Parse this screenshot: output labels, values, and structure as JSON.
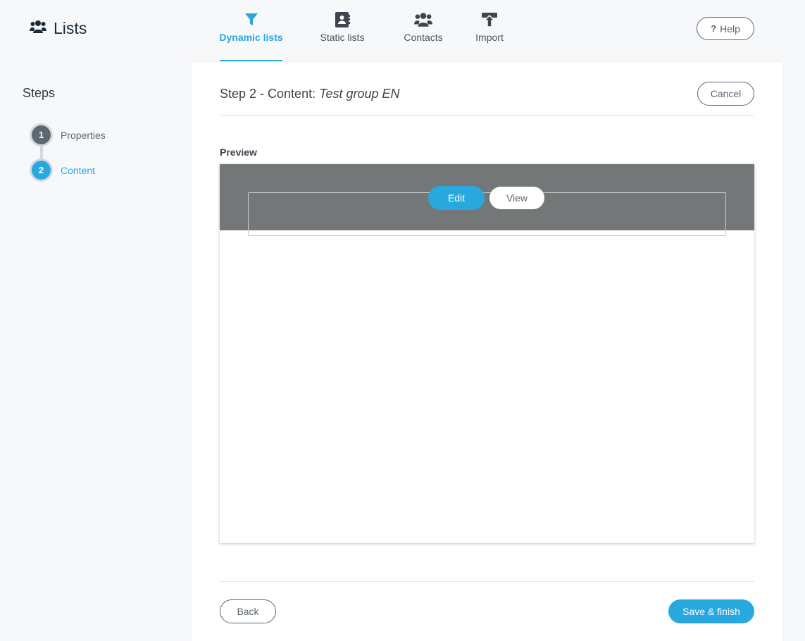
{
  "header": {
    "app_title": "Lists",
    "app_icon": "users-icon",
    "nav": [
      {
        "label": "Dynamic lists",
        "icon": "filter-icon",
        "active": true
      },
      {
        "label": "Static lists",
        "icon": "address-book-icon",
        "active": false
      },
      {
        "label": "Contacts",
        "icon": "users-icon",
        "active": false
      },
      {
        "label": "Import",
        "icon": "upload-icon",
        "active": false
      }
    ],
    "help_icon": "?",
    "help_label": "Help"
  },
  "sidebar": {
    "title": "Steps",
    "steps": [
      {
        "number": "1",
        "label": "Properties",
        "state": "done"
      },
      {
        "number": "2",
        "label": "Content",
        "state": "current"
      }
    ]
  },
  "main": {
    "title_prefix": "Step 2 - Content:",
    "title_name": "Test group EN",
    "cancel_label": "Cancel",
    "preview_label": "Preview",
    "edit_label": "Edit",
    "view_label": "View",
    "back_label": "Back",
    "save_label": "Save & finish"
  },
  "colors": {
    "accent": "#29a8e0",
    "dark_icon": "#3d454d",
    "preview_band": "#737777"
  }
}
